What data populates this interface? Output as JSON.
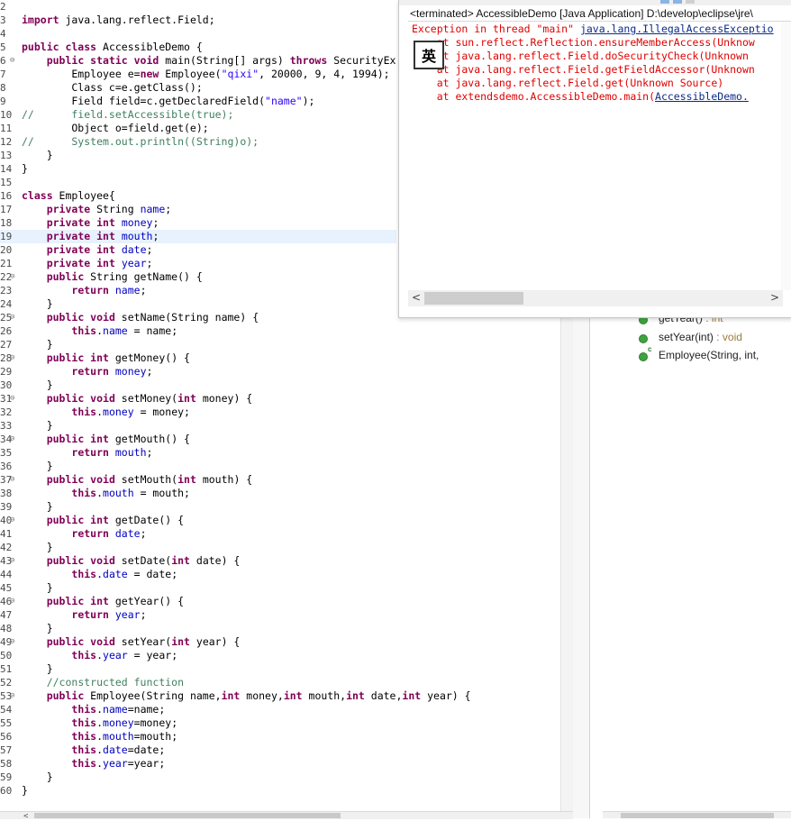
{
  "editor": {
    "lines": [
      {
        "n": "2",
        "html": ""
      },
      {
        "n": "3",
        "html": "<span class=\"kw\">import</span> java.lang.reflect.Field;"
      },
      {
        "n": "4",
        "html": ""
      },
      {
        "n": "5",
        "html": "<span class=\"kw\">public class</span> AccessibleDemo {"
      },
      {
        "n": "6",
        "fold": true,
        "html": "    <span class=\"kw\">public static void</span> main(String[] args) <span class=\"kw\">throws</span> SecurityEx"
      },
      {
        "n": "7",
        "html": "        Employee e=<span class=\"kw\">new</span> Employee(<span class=\"str\">\"qixi\"</span>, 20000, 9, 4, 1994);"
      },
      {
        "n": "8",
        "html": "        Class c=e.getClass();"
      },
      {
        "n": "9",
        "html": "        Field field=c.getDeclaredField(<span class=\"str\">\"name\"</span>);"
      },
      {
        "n": "10",
        "html": "<span class=\"cmt\">//      field.setAccessible(true);</span>"
      },
      {
        "n": "11",
        "html": "        Object o=field.get(e);"
      },
      {
        "n": "12",
        "html": "<span class=\"cmt\">//      System.out.println((String)o);</span>"
      },
      {
        "n": "13",
        "html": "    }"
      },
      {
        "n": "14",
        "html": "}"
      },
      {
        "n": "15",
        "html": ""
      },
      {
        "n": "16",
        "html": "<span class=\"kw\">class</span> Employee{"
      },
      {
        "n": "17",
        "html": "    <span class=\"kw\">private</span> String <span class=\"fld\">name</span>;"
      },
      {
        "n": "18",
        "html": "    <span class=\"kw\">private int</span> <span class=\"fld\">money</span>;"
      },
      {
        "n": "19",
        "hl": true,
        "html": "    <span class=\"kw\">private int</span> <span class=\"fld\">mouth</span>;"
      },
      {
        "n": "20",
        "html": "    <span class=\"kw\">private int</span> <span class=\"fld\">date</span>;"
      },
      {
        "n": "21",
        "html": "    <span class=\"kw\">private int</span> <span class=\"fld\">year</span>;"
      },
      {
        "n": "22",
        "fold": true,
        "html": "    <span class=\"kw\">public</span> String getName() {"
      },
      {
        "n": "23",
        "html": "        <span class=\"kw\">return</span> <span class=\"fld\">name</span>;"
      },
      {
        "n": "24",
        "html": "    }"
      },
      {
        "n": "25",
        "fold": true,
        "html": "    <span class=\"kw\">public void</span> setName(String name) {"
      },
      {
        "n": "26",
        "html": "        <span class=\"kw\">this</span>.<span class=\"fld\">name</span> = name;"
      },
      {
        "n": "27",
        "html": "    }"
      },
      {
        "n": "28",
        "fold": true,
        "html": "    <span class=\"kw\">public int</span> getMoney() {"
      },
      {
        "n": "29",
        "html": "        <span class=\"kw\">return</span> <span class=\"fld\">money</span>;"
      },
      {
        "n": "30",
        "html": "    }"
      },
      {
        "n": "31",
        "fold": true,
        "html": "    <span class=\"kw\">public void</span> setMoney(<span class=\"kw\">int</span> money) {"
      },
      {
        "n": "32",
        "html": "        <span class=\"kw\">this</span>.<span class=\"fld\">money</span> = money;"
      },
      {
        "n": "33",
        "html": "    }"
      },
      {
        "n": "34",
        "fold": true,
        "html": "    <span class=\"kw\">public int</span> getMouth() {"
      },
      {
        "n": "35",
        "html": "        <span class=\"kw\">return</span> <span class=\"fld\">mouth</span>;"
      },
      {
        "n": "36",
        "html": "    }"
      },
      {
        "n": "37",
        "fold": true,
        "html": "    <span class=\"kw\">public void</span> setMouth(<span class=\"kw\">int</span> mouth) {"
      },
      {
        "n": "38",
        "html": "        <span class=\"kw\">this</span>.<span class=\"fld\">mouth</span> = mouth;"
      },
      {
        "n": "39",
        "html": "    }"
      },
      {
        "n": "40",
        "fold": true,
        "html": "    <span class=\"kw\">public int</span> getDate() {"
      },
      {
        "n": "41",
        "html": "        <span class=\"kw\">return</span> <span class=\"fld\">date</span>;"
      },
      {
        "n": "42",
        "html": "    }"
      },
      {
        "n": "43",
        "fold": true,
        "html": "    <span class=\"kw\">public void</span> setDate(<span class=\"kw\">int</span> date) {"
      },
      {
        "n": "44",
        "html": "        <span class=\"kw\">this</span>.<span class=\"fld\">date</span> = date;"
      },
      {
        "n": "45",
        "html": "    }"
      },
      {
        "n": "46",
        "fold": true,
        "html": "    <span class=\"kw\">public int</span> getYear() {"
      },
      {
        "n": "47",
        "html": "        <span class=\"kw\">return</span> <span class=\"fld\">year</span>;"
      },
      {
        "n": "48",
        "html": "    }"
      },
      {
        "n": "49",
        "fold": true,
        "html": "    <span class=\"kw\">public void</span> setYear(<span class=\"kw\">int</span> year) {"
      },
      {
        "n": "50",
        "html": "        <span class=\"kw\">this</span>.<span class=\"fld\">year</span> = year;"
      },
      {
        "n": "51",
        "html": "    }"
      },
      {
        "n": "52",
        "html": "    <span class=\"cmt\">//constructed function</span>"
      },
      {
        "n": "53",
        "fold": true,
        "html": "    <span class=\"kw\">public</span> Employee(String name,<span class=\"kw\">int</span> money,<span class=\"kw\">int</span> mouth,<span class=\"kw\">int</span> date,<span class=\"kw\">int</span> year) {"
      },
      {
        "n": "54",
        "html": "        <span class=\"kw\">this</span>.<span class=\"fld\">name</span>=name;"
      },
      {
        "n": "55",
        "html": "        <span class=\"kw\">this</span>.<span class=\"fld\">money</span>=money;"
      },
      {
        "n": "56",
        "html": "        <span class=\"kw\">this</span>.<span class=\"fld\">mouth</span>=mouth;"
      },
      {
        "n": "57",
        "html": "        <span class=\"kw\">this</span>.<span class=\"fld\">date</span>=date;"
      },
      {
        "n": "58",
        "html": "        <span class=\"kw\">this</span>.<span class=\"fld\">year</span>=year;"
      },
      {
        "n": "59",
        "html": "    }"
      },
      {
        "n": "60",
        "html": "}"
      }
    ]
  },
  "console": {
    "header": "<terminated> AccessibleDemo [Java Application] D:\\develop\\eclipse\\jre\\",
    "ime_label": "英",
    "exception_prefix": "Exception in thread \"main\" ",
    "exception_link": "java.lang.IllegalAccessExceptio",
    "trace": [
      "    at sun.reflect.Reflection.ensureMemberAccess(Unknow",
      "    at java.lang.reflect.Field.doSecurityCheck(Unknown",
      "    at java.lang.reflect.Field.getFieldAccessor(Unknown",
      "    at java.lang.reflect.Field.get(Unknown Source)"
    ],
    "last_prefix": "    at extendsdemo.AccessibleDemo.main(",
    "last_link": "AccessibleDemo.",
    "scroll_left": "<",
    "scroll_right": ">"
  },
  "outline": {
    "items": [
      {
        "name": "getYear()",
        "type": " : int"
      },
      {
        "name": "setYear(int)",
        "type": " : void"
      },
      {
        "name": "Employee(String, int, ",
        "type": "",
        "ctor": true
      }
    ],
    "ctor_marker": "c"
  },
  "editor_scroll_left": "<"
}
